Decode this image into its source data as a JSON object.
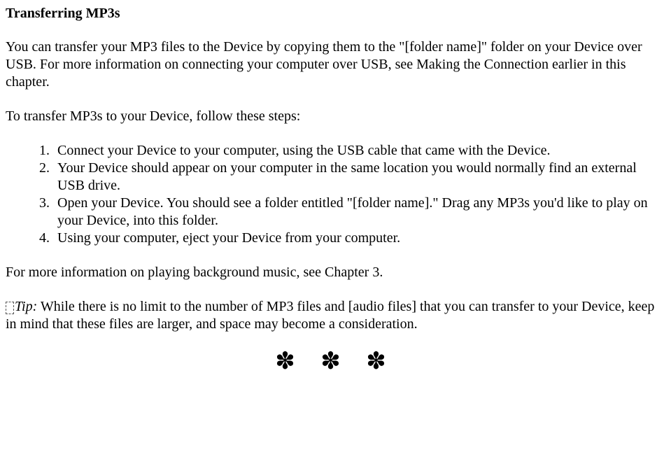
{
  "heading": "Transferring MP3s",
  "intro": "You can transfer your MP3 files to the Device by copying them to the \"[folder name]\" folder on your Device over USB. For more information on connecting your computer over USB, see Making the Connection earlier in this chapter.",
  "steps_lead": "To transfer MP3s to your Device, follow these steps:",
  "steps": [
    "Connect your Device to your computer, using the USB cable that came with the Device.",
    "Your Device should appear on your computer in the same location you would normally find an external USB drive.",
    "Open your Device. You should see a folder entitled \"[folder name].\" Drag any MP3s you'd like to play on your Device, into this folder.",
    "Using your computer, eject your Device from your computer."
  ],
  "more_info": "For more information on playing background music, see Chapter 3.",
  "tip_label": "Tip:",
  "tip_body": " While there is no limit to the number of MP3 files and [audio files] that you can transfer to your Device, keep in mind that these files are larger, and space may become a consideration.",
  "divider": "✽ ✽ ✽"
}
